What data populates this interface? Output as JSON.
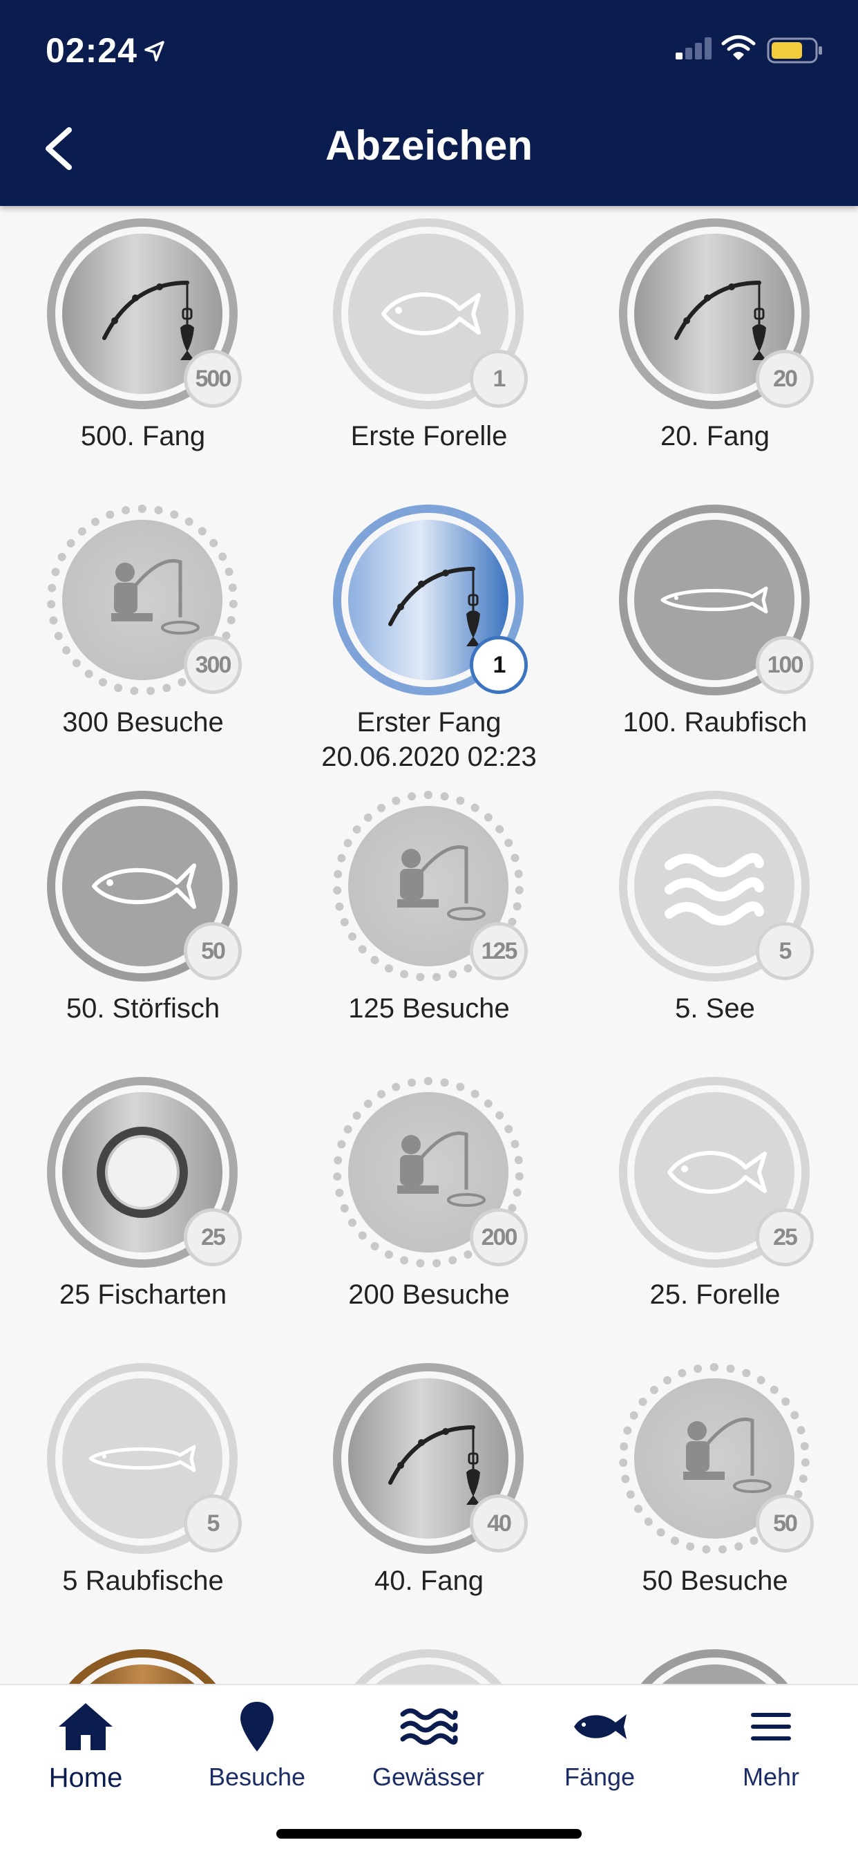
{
  "status_bar": {
    "time": "02:24"
  },
  "header": {
    "title": "Abzeichen"
  },
  "badges": [
    {
      "label": "500. Fang",
      "count": "500",
      "icon": "fishing-rod-icon",
      "style": "silver"
    },
    {
      "label": "Erste Forelle",
      "count": "1",
      "icon": "fish-icon",
      "style": "light"
    },
    {
      "label": "20. Fang",
      "count": "20",
      "icon": "fishing-rod-icon",
      "style": "silver"
    },
    {
      "label": "300 Besuche",
      "count": "300",
      "icon": "angler-icon",
      "style": "speckle"
    },
    {
      "label": "Erster Fang\n20.06.2020 02:23",
      "count": "1",
      "icon": "fishing-rod-icon",
      "style": "blue"
    },
    {
      "label": "100. Raubfisch",
      "count": "100",
      "icon": "pike-icon",
      "style": "dark"
    },
    {
      "label": "50. Störfisch",
      "count": "50",
      "icon": "tuna-icon",
      "style": "dark"
    },
    {
      "label": "125 Besuche",
      "count": "125",
      "icon": "angler-icon",
      "style": "speckle"
    },
    {
      "label": "5. See",
      "count": "5",
      "icon": "waves-icon",
      "style": "light"
    },
    {
      "label": "25 Fischarten",
      "count": "25",
      "icon": "fish-circle-icon",
      "style": "silver"
    },
    {
      "label": "200 Besuche",
      "count": "200",
      "icon": "angler-icon",
      "style": "speckle"
    },
    {
      "label": "25. Forelle",
      "count": "25",
      "icon": "fish-icon",
      "style": "light"
    },
    {
      "label": "5 Raubfische",
      "count": "5",
      "icon": "pike-icon",
      "style": "light"
    },
    {
      "label": "40. Fang",
      "count": "40",
      "icon": "fishing-rod-icon",
      "style": "silver"
    },
    {
      "label": "50 Besuche",
      "count": "50",
      "icon": "angler-icon",
      "style": "speckle"
    },
    {
      "label": "",
      "count": "",
      "icon": "",
      "style": "bronze"
    },
    {
      "label": "",
      "count": "",
      "icon": "",
      "style": "light"
    },
    {
      "label": "",
      "count": "",
      "icon": "",
      "style": "dark"
    }
  ],
  "tabbar": {
    "items": [
      {
        "label": "Home",
        "icon": "home-icon",
        "active": true
      },
      {
        "label": "Besuche",
        "icon": "map-pin-icon",
        "active": false
      },
      {
        "label": "Gewässer",
        "icon": "waves-icon",
        "active": false
      },
      {
        "label": "Fänge",
        "icon": "fish-icon",
        "active": false
      },
      {
        "label": "Mehr",
        "icon": "menu-icon",
        "active": false
      }
    ]
  },
  "colors": {
    "header_bg": "#0b1c4e",
    "accent_blue": "#3c74c0",
    "tab_text": "#1c2d66"
  }
}
